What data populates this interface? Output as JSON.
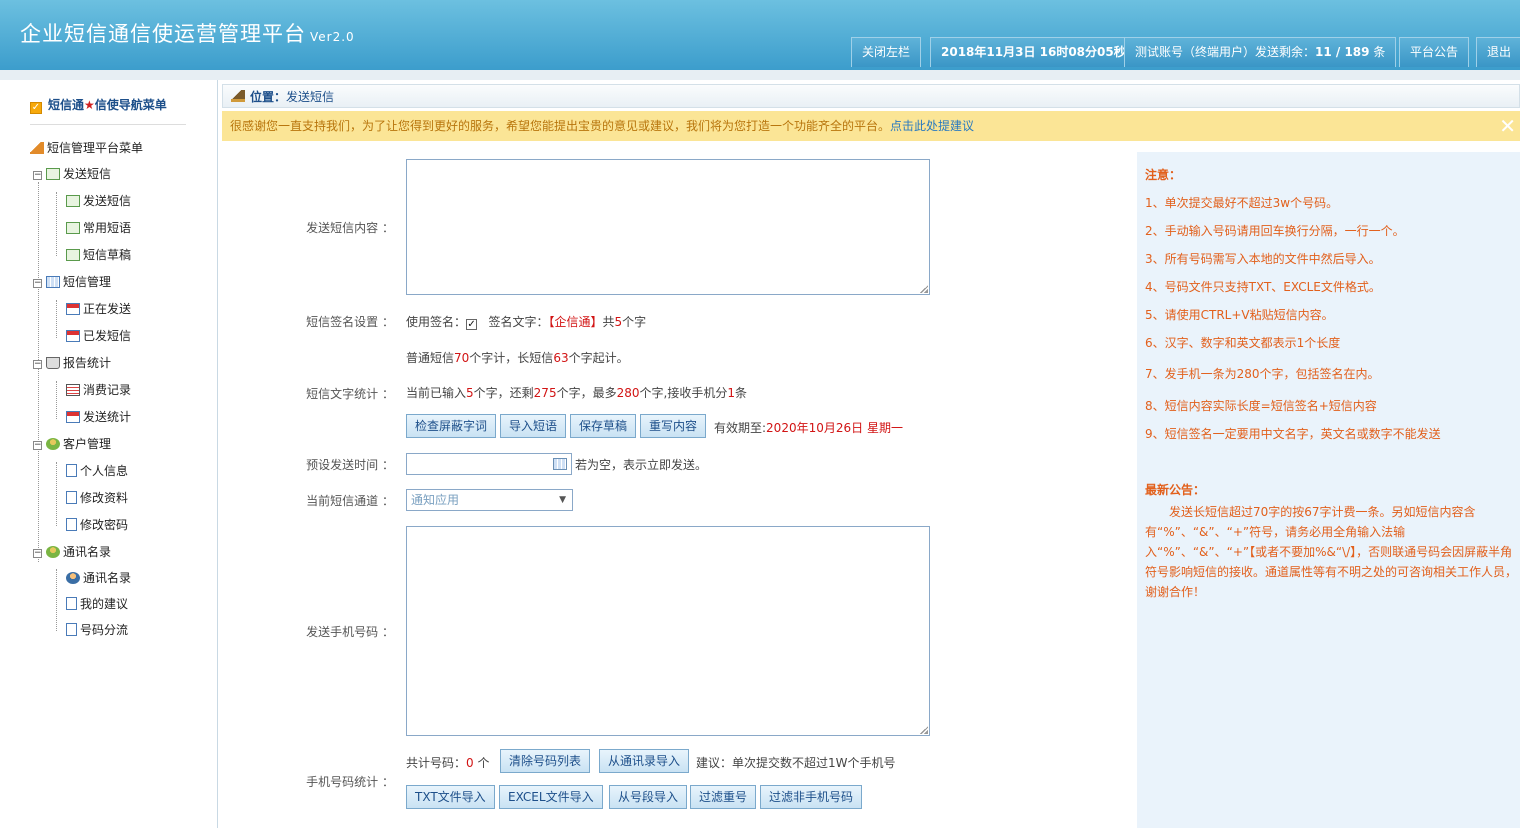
{
  "header": {
    "title": "企业短信通信使运营管理平台",
    "version": "Ver2.0",
    "buttons": {
      "close_sidebar": "关闭左栏",
      "datetime": "2018年11月3日 16时08分05秒",
      "account_prefix": "测试账号（终端用户）发送剩余：",
      "account_count": "11 / 189",
      "account_suffix": " 条",
      "announcement": "平台公告",
      "logout": "退出"
    }
  },
  "sidebar": {
    "title_a": "短信通",
    "title_star": "★",
    "title_b": "信使导航菜单",
    "root": "短信管理平台菜单",
    "groups": [
      {
        "label": "发送短信",
        "items": [
          "发送短信",
          "常用短语",
          "短信草稿"
        ]
      },
      {
        "label": "短信管理",
        "items": [
          "正在发送",
          "已发短信"
        ]
      },
      {
        "label": "报告统计",
        "items": [
          "消费记录",
          "发送统计"
        ]
      },
      {
        "label": "客户管理",
        "items": [
          "个人信息",
          "修改资料",
          "修改密码"
        ]
      },
      {
        "label": "通讯名录",
        "items": [
          "通讯名录",
          "我的建议",
          "号码分流"
        ]
      }
    ]
  },
  "breadcrumb": {
    "prefix": "位置：",
    "current": "发送短信"
  },
  "notice": {
    "text": "很感谢您一直支持我们，为了让您得到更好的服务，希望您能提出宝贵的意见或建议，我们将为您打造一个功能齐全的平台。",
    "link": "点击此处提建议",
    "close": "✕"
  },
  "form": {
    "content_label": "发送短信内容 ：",
    "signature_label": "短信签名设置 ：",
    "use_signature": "使用签名：",
    "signature_text_label": "签名文字：",
    "signature_value": "【企信通】",
    "signature_count_prefix": "共",
    "signature_count": "5",
    "signature_count_suffix": "个字",
    "length_note_a": "普通短信",
    "length_note_n1": "70",
    "length_note_b": "个字计，长短信",
    "length_note_n2": "63",
    "length_note_c": "个字起计。",
    "stats_label": "短信文字统计 ：",
    "stats_a": "当前已输入",
    "stats_n1": "5",
    "stats_b": "个字，还剩",
    "stats_n2": "275",
    "stats_c": "个字，最多",
    "stats_n3": "280",
    "stats_d": "个字,接收手机分",
    "stats_n4": "1",
    "stats_e": "条",
    "buttons_row1": [
      "检查屏蔽字词",
      "导入短语",
      "保存草稿",
      "重写内容"
    ],
    "expiry_label": "有效期至:",
    "expiry_value": "2020年10月26日 星期一",
    "schedule_label": "预设发送时间 ：",
    "schedule_value": "",
    "schedule_hint": "若为空，表示立即发送。",
    "channel_label": "当前短信通道 ：",
    "channel_value": "通知应用",
    "phones_label": "发送手机号码 ：",
    "phone_stats_label": "手机号码统计 ：",
    "total_prefix": "共计号码：",
    "total_count": "0",
    "total_suffix": " 个",
    "buttons_row2": [
      "清除号码列表",
      "从通讯录导入"
    ],
    "suggestion": "建议：单次提交数不超过1W个手机号",
    "buttons_row3": [
      "TXT文件导入",
      "EXCEL文件导入",
      "从号段导入",
      "过滤重号",
      "过滤非手机号码"
    ]
  },
  "notes": {
    "title": "注意：",
    "items": [
      "1、单次提交最好不超过3w个号码。",
      "2、手动输入号码请用回车换行分隔，一行一个。",
      "3、所有号码需写入本地的文件中然后导入。",
      "4、号码文件只支持TXT、EXCLE文件格式。",
      "5、请使用CTRL+V粘贴短信内容。",
      "6、汉字、数字和英文都表示1个长度",
      "7、发手机一条为280个字，包括签名在内。",
      "8、短信内容实际长度=短信签名+短信内容",
      "9、短信签名一定要用中文名字，英文名或数字不能发送"
    ],
    "announcement_title": "最新公告：",
    "announcement_text": "发送长短信超过70字的按67字计费一条。另如短信内容含有“%”、“&”、“+”符号，请务必用全角输入法输入“%”、“&”、“+”【或者不要加%&“\\/】，否则联通号码会因屏蔽半角符号影响短信的接收。通道属性等有不明之处的可咨询相关工作人员，谢谢合作！"
  }
}
